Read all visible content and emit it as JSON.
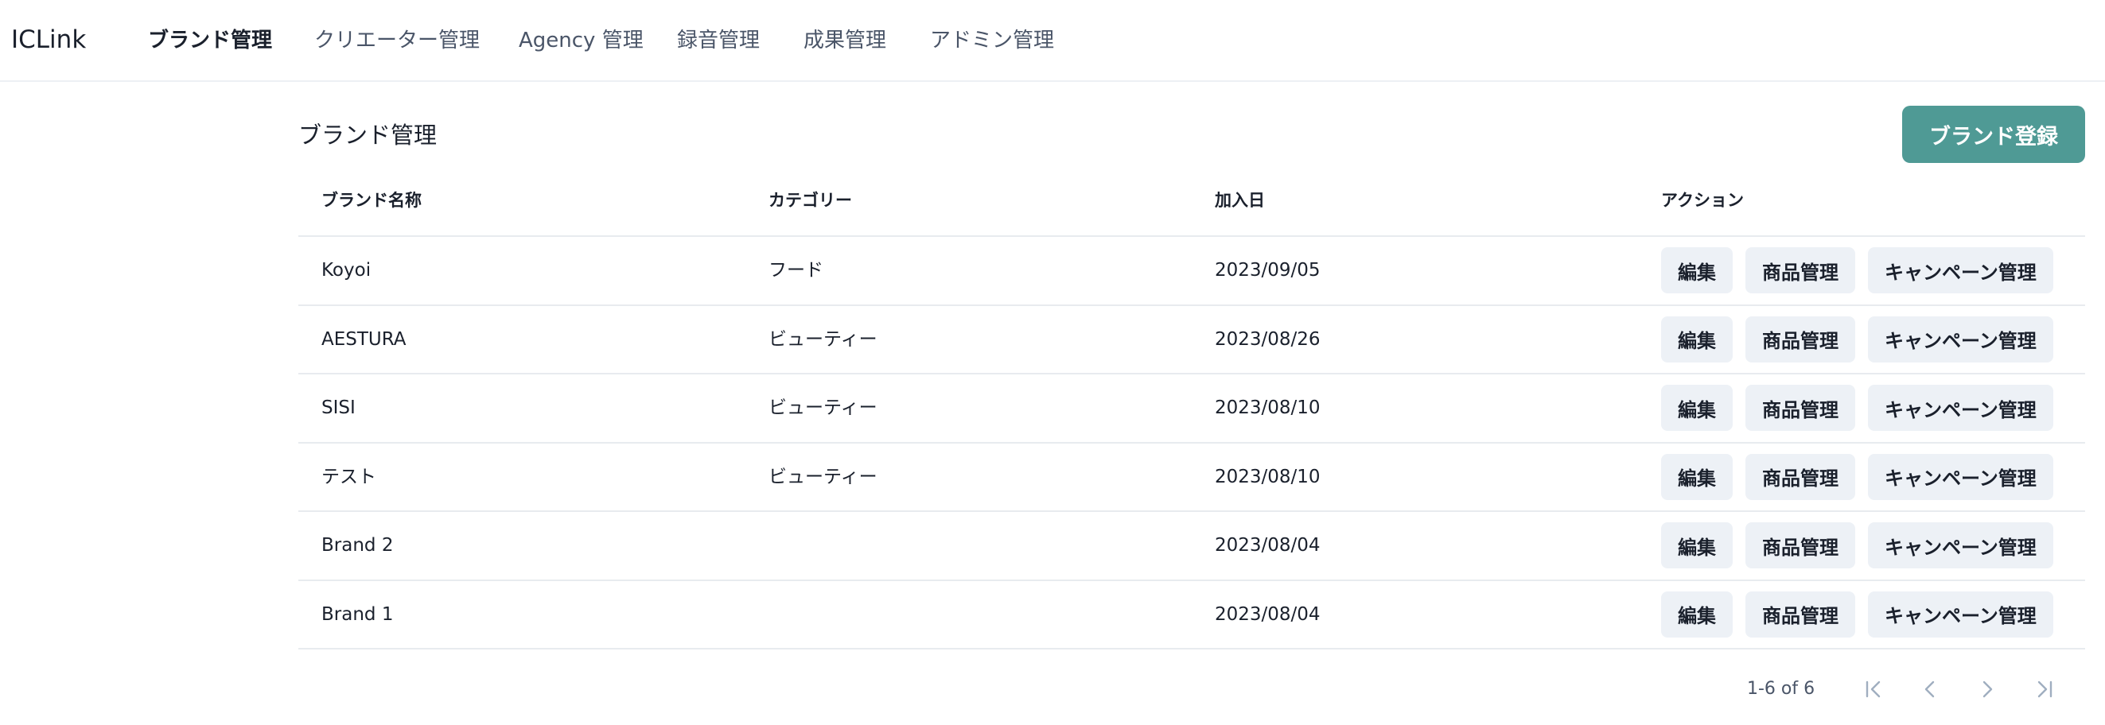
{
  "app": {
    "logo": "ICLink"
  },
  "nav": {
    "items": [
      {
        "label": "ブランド管理",
        "active": true
      },
      {
        "label": "クリエーター管理",
        "active": false
      },
      {
        "label": "Agency 管理",
        "active": false
      },
      {
        "label": "録音管理",
        "active": false
      },
      {
        "label": "成果管理",
        "active": false
      },
      {
        "label": "アドミン管理",
        "active": false
      }
    ]
  },
  "page": {
    "title": "ブランド管理",
    "primary_button_label": "ブランド登録"
  },
  "table": {
    "headers": [
      "ブランド名称",
      "カテゴリー",
      "加入日",
      "アクション"
    ],
    "action_labels": {
      "edit": "編集",
      "products": "商品管理",
      "campaigns": "キャンペーン管理"
    },
    "rows": [
      {
        "name": "Koyoi",
        "category": "フード",
        "joined": "2023/09/05"
      },
      {
        "name": "AESTURA",
        "category": "ビューティー",
        "joined": "2023/08/26"
      },
      {
        "name": "SISI",
        "category": "ビューティー",
        "joined": "2023/08/10"
      },
      {
        "name": "テスト",
        "category": "ビューティー",
        "joined": "2023/08/10"
      },
      {
        "name": "Brand 2",
        "category": "",
        "joined": "2023/08/04"
      },
      {
        "name": "Brand 1",
        "category": "",
        "joined": "2023/08/04"
      }
    ]
  },
  "pagination": {
    "info": "1-6 of 6",
    "icons": [
      "first-page-icon",
      "previous-page-icon",
      "next-page-icon",
      "last-page-icon"
    ]
  },
  "colors": {
    "accent": "#4f9a95",
    "action_button_bg": "#edf1f6",
    "pager_icon": "#a0aec0",
    "divider": "#e8ebef"
  }
}
